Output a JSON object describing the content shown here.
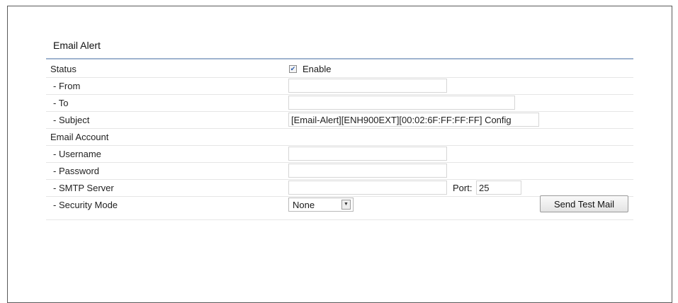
{
  "section": {
    "title": "Email Alert"
  },
  "rows": {
    "status": {
      "label": "Status",
      "enable_label": "Enable",
      "enabled": true,
      "check_glyph": "✔"
    },
    "from": {
      "label": "- From",
      "value": ""
    },
    "to": {
      "label": "- To",
      "value": ""
    },
    "subject": {
      "label": "- Subject",
      "value": "[Email-Alert][ENH900EXT][00:02:6F:FF:FF:FF] Config"
    },
    "email_account": {
      "label": "Email Account"
    },
    "username": {
      "label": "- Username",
      "value": ""
    },
    "password": {
      "label": "- Password",
      "value": ""
    },
    "smtp_server": {
      "label": "- SMTP Server",
      "value": "",
      "port_label": "Port:",
      "port_value": "25"
    },
    "security_mode": {
      "label": "- Security Mode",
      "selected": "None",
      "arrow_glyph": "▼",
      "button_label": "Send Test Mail"
    }
  }
}
